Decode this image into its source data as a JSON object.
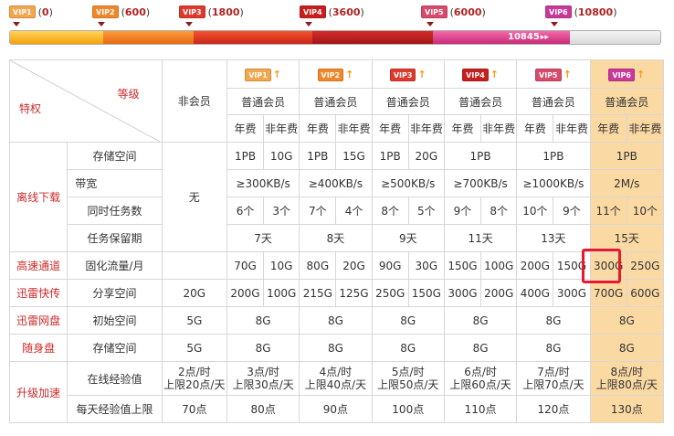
{
  "levels": [
    {
      "badge": "VIP1",
      "points": "0",
      "color": "#f3a64b"
    },
    {
      "badge": "VIP2",
      "points": "600",
      "color": "#f0882a"
    },
    {
      "badge": "VIP3",
      "points": "1800",
      "color": "#e0392c"
    },
    {
      "badge": "VIP4",
      "points": "3600",
      "color": "#c91e1e"
    },
    {
      "badge": "VIP5",
      "points": "6000",
      "color": "#d84a6c"
    },
    {
      "badge": "VIP6",
      "points": "10800",
      "color": "#c9399a"
    }
  ],
  "progress": {
    "current": "10845",
    "max": 10800
  },
  "table": {
    "corner_top": "等级",
    "corner_bottom": "特权",
    "non_member": "非会员",
    "regular_member": "普通会员",
    "annual": "年费",
    "non_annual": "非年费",
    "categories": {
      "offline": "离线下载",
      "highspeed": "高速通道",
      "xunlei_share": "迅雷快传",
      "xunlei_disk": "迅雷网盘",
      "portable": "随身盘",
      "upgrade": "升级加速"
    },
    "rows": {
      "storage": {
        "label": "存储空间",
        "values": [
          "1PB",
          "10G",
          "1PB",
          "15G",
          "1PB",
          "20G",
          "1PB",
          "1PB",
          "1PB"
        ]
      },
      "bandwidth": {
        "label": "带宽",
        "values": [
          "≥300KB/s",
          "≥400KB/s",
          "≥500KB/s",
          "≥700KB/s",
          "≥1000KB/s",
          "2M/s"
        ]
      },
      "tasks": {
        "label": "同时任务数",
        "non_member": "无",
        "values": [
          "6个",
          "3个",
          "7个",
          "4个",
          "8个",
          "5个",
          "9个",
          "8个",
          "10个",
          "9个",
          "11个",
          "10个"
        ]
      },
      "retention": {
        "label": "任务保留期",
        "values": [
          "7天",
          "8天",
          "9天",
          "11天",
          "13天",
          "15天"
        ]
      },
      "traffic": {
        "label": "固化流量/月",
        "values": [
          "70G",
          "10G",
          "80G",
          "20G",
          "90G",
          "30G",
          "150G",
          "100G",
          "200G",
          "150G",
          "300G",
          "250G"
        ]
      },
      "share": {
        "label": "分享空间",
        "non_member": "20G",
        "values": [
          "200G",
          "100G",
          "215G",
          "125G",
          "250G",
          "150G",
          "300G",
          "200G",
          "400G",
          "300G",
          "700G",
          "600G"
        ]
      },
      "disk": {
        "label": "初始空间",
        "non_member": "5G",
        "values": [
          "8G",
          "8G",
          "8G",
          "8G",
          "8G",
          "8G"
        ]
      },
      "portable_storage": {
        "label": "存储空间",
        "non_member": "5G",
        "values": [
          "8G",
          "8G",
          "8G",
          "8G",
          "8G",
          "8G"
        ]
      },
      "online_exp": {
        "label": "在线经验值",
        "values": [
          [
            "2点/时",
            "上限20点/天"
          ],
          [
            "3点/时",
            "上限30点/天"
          ],
          [
            "4点/时",
            "上限40点/天"
          ],
          [
            "5点/时",
            "上限50点/天"
          ],
          [
            "6点/时",
            "上限60点/天"
          ],
          [
            "7点/时",
            "上限70点/天"
          ],
          [
            "8点/时",
            "上限80点/天"
          ]
        ]
      },
      "daily_exp": {
        "label": "每天经验值上限",
        "values": [
          "70点",
          "80点",
          "90点",
          "100点",
          "110点",
          "120点",
          "130点"
        ]
      }
    }
  }
}
